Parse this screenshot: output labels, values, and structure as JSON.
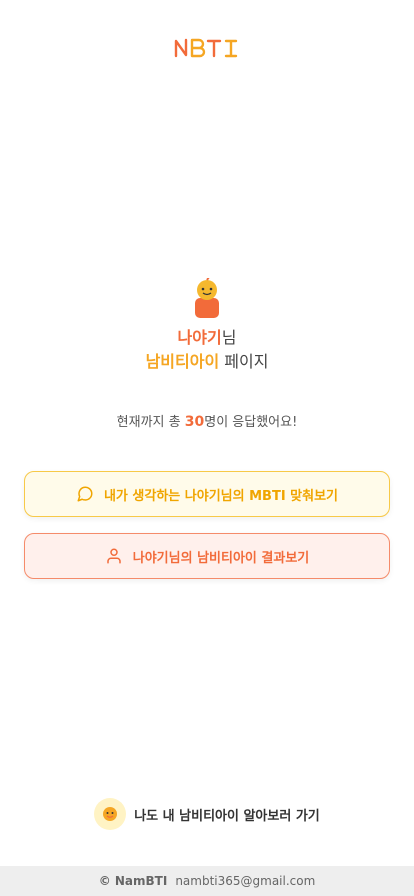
{
  "header": {
    "logo_text": "NBTI"
  },
  "profile": {
    "name": "나야기",
    "name_suffix": "님",
    "brand": "남비티아이",
    "page_suffix": " 페이지"
  },
  "stats": {
    "prefix": "현재까지 총 ",
    "count": "30",
    "suffix": "명이 응답했어요!"
  },
  "buttons": {
    "guess_label": "내가 생각하는 나야기님의 MBTI 맞춰보기",
    "result_label": "나야기님의 남비티아이 결과보기"
  },
  "cta": {
    "label": "나도 내 남비티아이 알아보러 가기"
  },
  "footer": {
    "copyright": "© NamBTI",
    "email": "nambti365@gmail.com"
  },
  "colors": {
    "orange": "#f26b3a",
    "yellow": "#f5a623"
  },
  "icons": [
    "logo-icon",
    "mascot-icon",
    "chat-bubble-icon",
    "user-icon",
    "mascot-avatar-icon"
  ]
}
